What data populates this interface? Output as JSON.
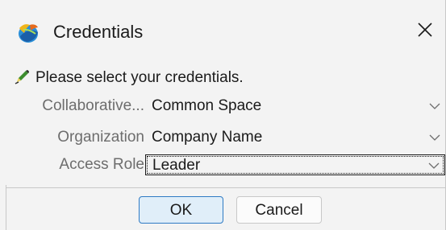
{
  "window": {
    "title": "Credentials",
    "icon": "app-logo-icon",
    "close_icon": "close-icon"
  },
  "instruction": {
    "icon": "pencil-icon",
    "text": "Please select your credentials."
  },
  "fields": [
    {
      "label": "Collaborative...",
      "value": "Common Space",
      "icon": "chevron-down-icon"
    },
    {
      "label": "Organization",
      "value": "Company Name",
      "icon": "chevron-down-icon"
    },
    {
      "label": "Access Role",
      "value": "Leader",
      "icon": "chevron-down-icon",
      "focused": true
    }
  ],
  "buttons": {
    "ok_label": "OK",
    "cancel_label": "Cancel"
  },
  "colors": {
    "ok_border": "#2f7bc4",
    "ok_fill": "#e0eef9",
    "label_text": "#6d6d6d"
  }
}
